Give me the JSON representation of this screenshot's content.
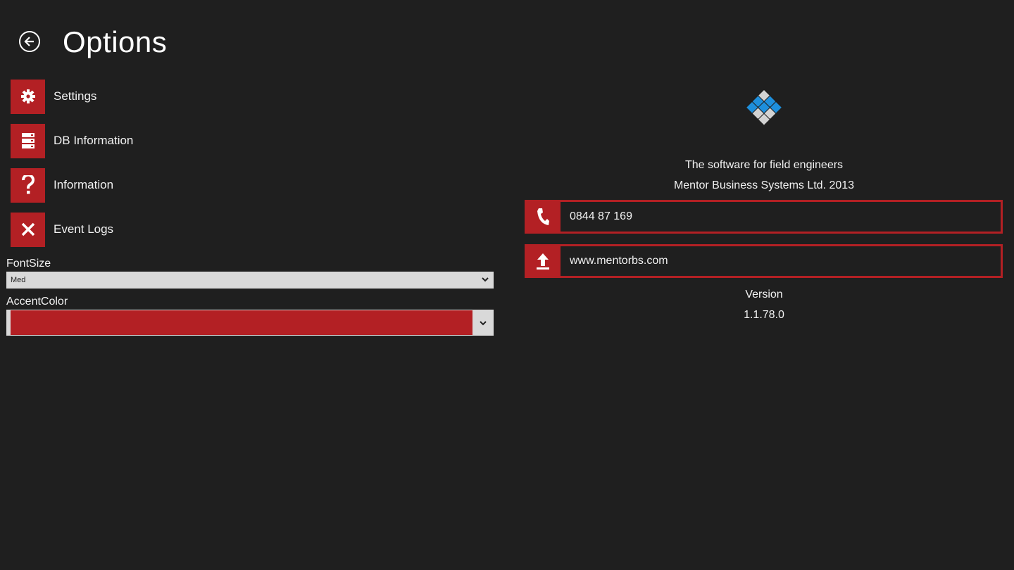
{
  "header": {
    "title": "Options",
    "back_icon": "back-arrow-icon"
  },
  "menu": {
    "items": [
      {
        "label": "Settings",
        "icon": "gear-icon"
      },
      {
        "label": "DB Information",
        "icon": "database-icon"
      },
      {
        "label": "Information",
        "icon": "question-icon"
      },
      {
        "label": "Event Logs",
        "icon": "close-icon"
      }
    ]
  },
  "font_size": {
    "label": "FontSize",
    "value": "Med"
  },
  "accent_color": {
    "label": "AccentColor",
    "value_color": "#b32024"
  },
  "about": {
    "logo_icon": "mentor-logo-icon",
    "tagline": "The software for field engineers",
    "company": "Mentor Business Systems Ltd. 2013",
    "phone": "0844 87   169",
    "website": "www.mentorbs.com",
    "version_label": "Version",
    "version_value": "1.1.78.0"
  },
  "colors": {
    "accent": "#b32024",
    "background": "#1f1f1f",
    "logo_blue": "#1e8fdc",
    "logo_grey": "#d3d3d3"
  }
}
